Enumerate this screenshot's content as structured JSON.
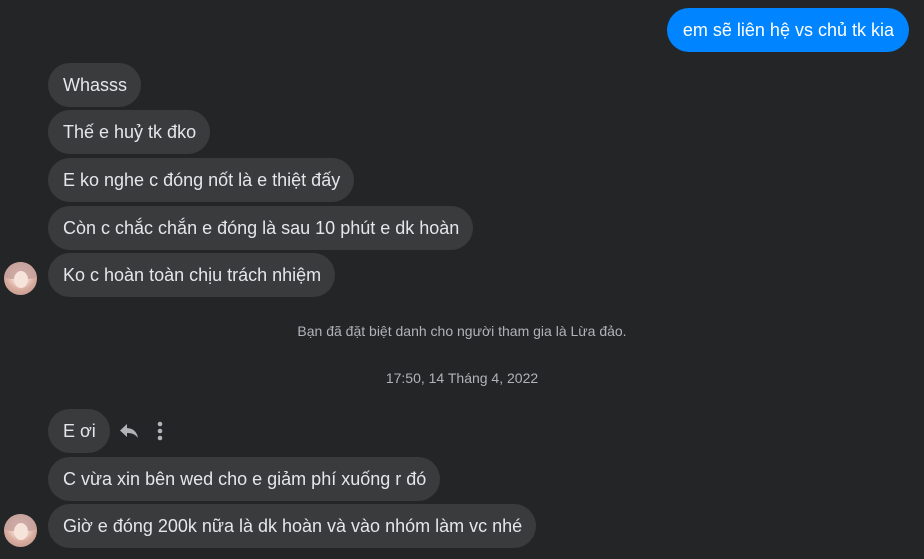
{
  "colors": {
    "background": "#242526",
    "incoming_bubble": "#3a3b3c",
    "outgoing_bubble": "#0084ff",
    "incoming_text": "#e4e6eb",
    "muted_text": "#b0b3b8"
  },
  "outgoing": [
    {
      "text": "em sẽ liên hệ vs chủ tk kia"
    }
  ],
  "group1": [
    {
      "text": "Whasss"
    },
    {
      "text": "Thế e huỷ tk đko"
    },
    {
      "text": "E ko nghe c đóng nốt là e thiệt đấy"
    },
    {
      "text": "Còn c chắc chắn e đóng là sau 10 phút e dk hoàn"
    },
    {
      "text": "Ko c hoàn toàn chịu trách nhiệm"
    }
  ],
  "system_note": "Bạn đã đặt biệt danh cho người tham gia là Lừa đảo.",
  "timestamp": "17:50, 14 Tháng 4, 2022",
  "group2": [
    {
      "text": "E ơi"
    },
    {
      "text": "C vừa xin bên wed cho e giảm phí xuống r đó"
    },
    {
      "text": "Giờ e đóng 200k nữa là dk hoàn và vào nhóm làm vc nhé"
    }
  ],
  "hover_actions": {
    "reply_icon": "reply-icon",
    "more_icon": "more-vertical-icon"
  }
}
